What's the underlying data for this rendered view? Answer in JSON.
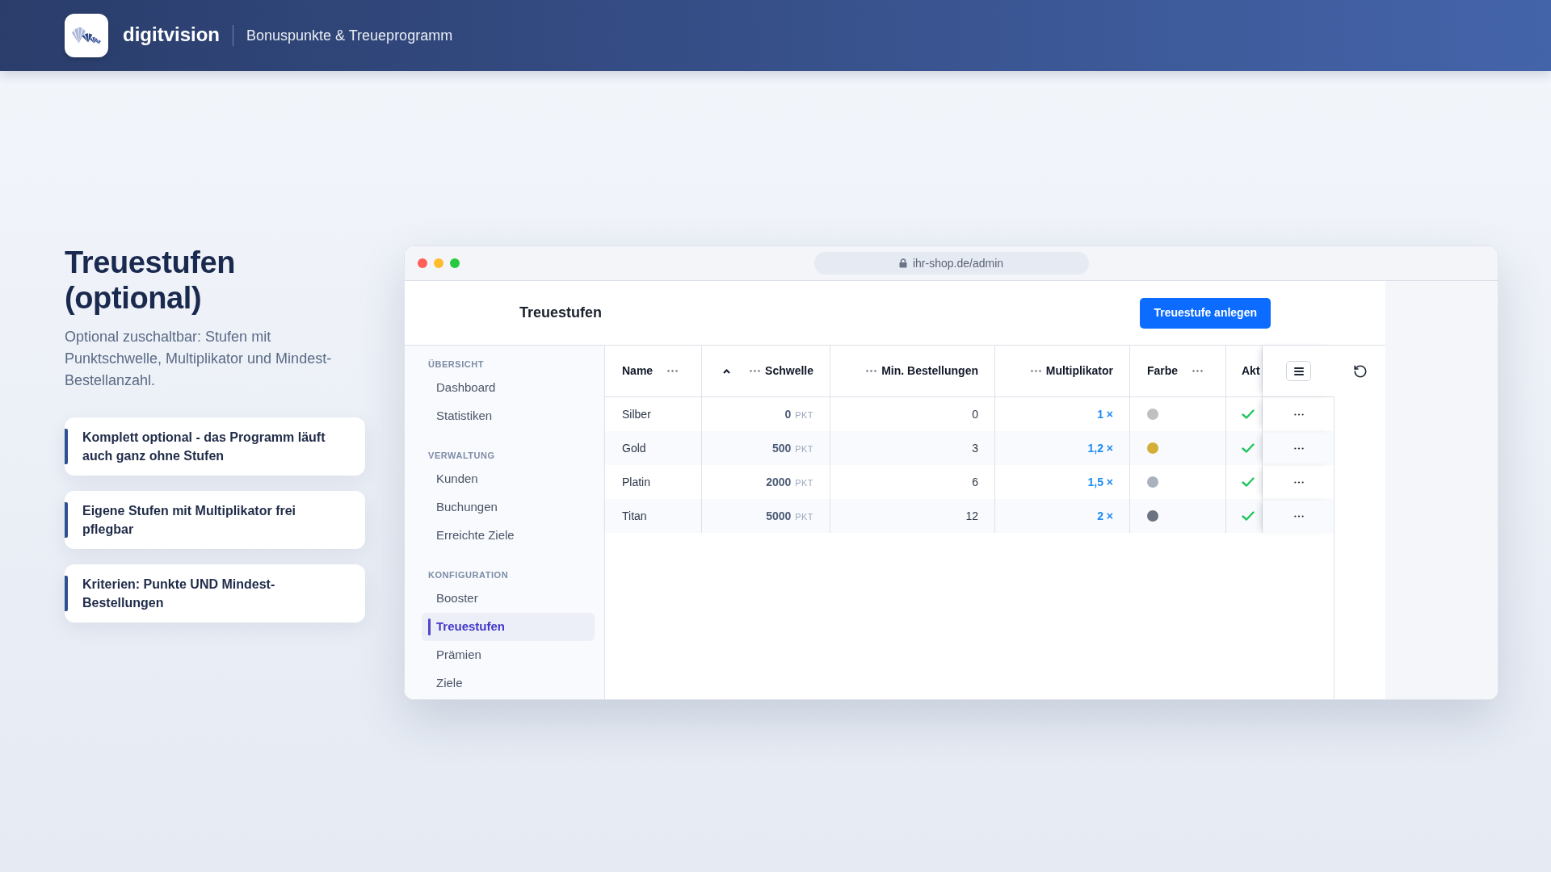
{
  "header": {
    "brand": "digitvision",
    "subtitle": "Bonuspunkte & Treueprogramm"
  },
  "intro": {
    "title": "Treuestufen (optional)",
    "description": "Optional zuschaltbar: Stufen mit Punktschwelle, Multiplikator und Mindest-Bestellanzahl.",
    "features": [
      "Komplett optional - das Programm läuft auch ganz ohne Stufen",
      "Eigene Stufen mit Multiplikator frei pflegbar",
      "Kriterien: Punkte UND Mindest-Bestellungen"
    ]
  },
  "browser": {
    "url": "ihr-shop.de/admin"
  },
  "app": {
    "title": "Treuestufen",
    "create_button": "Treuestufe anlegen",
    "sidebar": [
      {
        "heading": "ÜBERSICHT",
        "items": [
          {
            "label": "Dashboard",
            "selected": false
          },
          {
            "label": "Statistiken",
            "selected": false
          }
        ]
      },
      {
        "heading": "VERWALTUNG",
        "items": [
          {
            "label": "Kunden",
            "selected": false
          },
          {
            "label": "Buchungen",
            "selected": false
          },
          {
            "label": "Erreichte Ziele",
            "selected": false
          }
        ]
      },
      {
        "heading": "KONFIGURATION",
        "items": [
          {
            "label": "Booster",
            "selected": false
          },
          {
            "label": "Treuestufen",
            "selected": true
          },
          {
            "label": "Prämien",
            "selected": false
          },
          {
            "label": "Ziele",
            "selected": false
          }
        ]
      }
    ],
    "table": {
      "columns": [
        {
          "label": "Name",
          "kind": "name",
          "menu": true,
          "sorted": false
        },
        {
          "label": "Schwelle",
          "kind": "points",
          "menu": true,
          "sorted": true
        },
        {
          "label": "Min. Bestellungen",
          "kind": "number",
          "menu": true,
          "sorted": false
        },
        {
          "label": "Multiplikator",
          "kind": "multiplier",
          "menu": true,
          "sorted": false
        },
        {
          "label": "Farbe",
          "kind": "color",
          "menu": true,
          "sorted": false
        },
        {
          "label": "Akt",
          "kind": "check",
          "menu": false,
          "sorted": false
        }
      ],
      "rows": [
        {
          "name": "Silber",
          "threshold": "0",
          "unit": "PKT",
          "min_orders": "0",
          "multiplier": "1 ×",
          "color": "#c0c0c0",
          "active": true
        },
        {
          "name": "Gold",
          "threshold": "500",
          "unit": "PKT",
          "min_orders": "3",
          "multiplier": "1,2 ×",
          "color": "#d4af37",
          "active": true
        },
        {
          "name": "Platin",
          "threshold": "2000",
          "unit": "PKT",
          "min_orders": "6",
          "multiplier": "1,5 ×",
          "color": "#aab3bd",
          "active": true
        },
        {
          "name": "Titan",
          "threshold": "5000",
          "unit": "PKT",
          "min_orders": "12",
          "multiplier": "2 ×",
          "color": "#6b7380",
          "active": true
        }
      ]
    }
  }
}
